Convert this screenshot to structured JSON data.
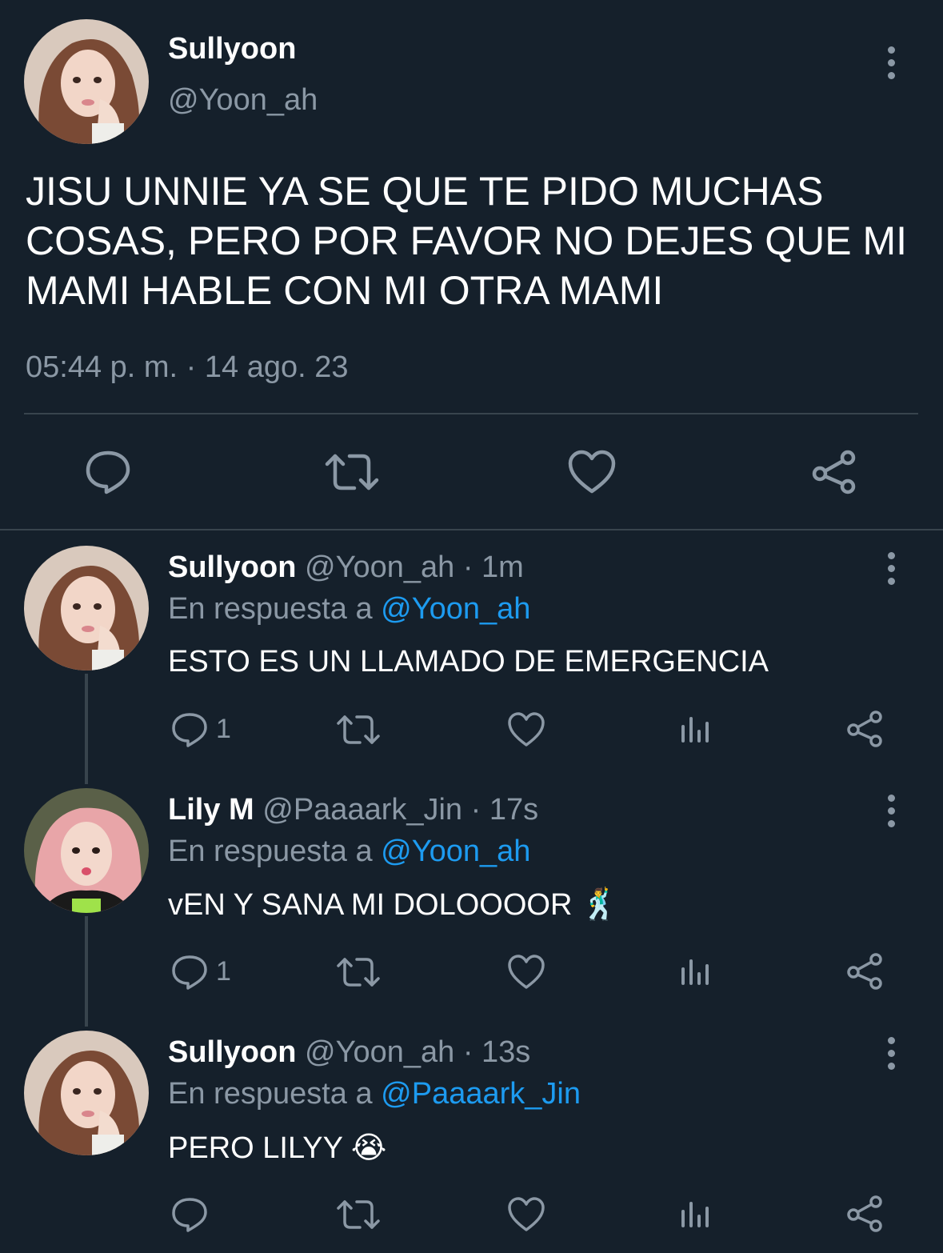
{
  "main_tweet": {
    "display_name": "Sullyoon",
    "handle": "@Yoon_ah",
    "text_lines": [
      "JISU UNNIE YA SE QUE TE PIDO MUCHAS",
      "COSAS, PERO POR FAVOR NO DEJES QUE MI",
      "MAMI HABLE CON MI OTRA MAMI"
    ],
    "timestamp": "05:44 p. m. · 14 ago. 23",
    "actions": [
      "reply-icon",
      "retweet-icon",
      "like-icon",
      "share-icon"
    ]
  },
  "replies": [
    {
      "display_name": "Sullyoon",
      "handle": "@Yoon_ah",
      "time": "· 1m",
      "reply_prefix": "En respuesta a",
      "reply_to": "@Yoon_ah",
      "text": "ESTO ES UN LLAMADO DE EMERGENCIA",
      "emoji": "",
      "reply_count": "1"
    },
    {
      "display_name": "Lily M",
      "handle": "@Paaaark_Jin",
      "time": "· 17s",
      "reply_prefix": "En respuesta a",
      "reply_to": "@Yoon_ah",
      "text": "vEN Y SANA MI DOLOOOOR",
      "emoji": "🕺",
      "reply_count": "1"
    },
    {
      "display_name": "Sullyoon",
      "handle": "@Yoon_ah",
      "time": "· 13s",
      "reply_prefix": "En respuesta a",
      "reply_to": "@Paaaark_Jin",
      "text": "PERO LILYY",
      "emoji": "😭",
      "reply_count": ""
    }
  ],
  "colors": {
    "background": "#15202b",
    "text": "#ffffff",
    "muted": "#8b98a5",
    "link": "#1d9bf0",
    "divider": "#38444d"
  }
}
